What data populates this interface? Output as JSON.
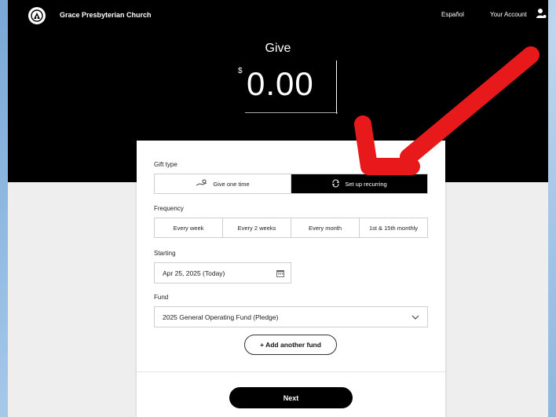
{
  "header": {
    "church_name": "Grace Presbyterian Church",
    "language_link": "Español",
    "account_link": "Your Account"
  },
  "give": {
    "title": "Give",
    "currency_symbol": "$",
    "amount": "0.00"
  },
  "form": {
    "gift_type_label": "Gift type",
    "gift_types": [
      {
        "label": "Give one time",
        "icon": "hand-coin-icon",
        "selected": false
      },
      {
        "label": "Set up recurring",
        "icon": "recurring-icon",
        "selected": true
      }
    ],
    "frequency_label": "Frequency",
    "frequencies": [
      "Every week",
      "Every 2 weeks",
      "Every month",
      "1st & 15th monthly"
    ],
    "starting_label": "Starting",
    "starting_value": "Apr 25, 2025 (Today)",
    "fund_label": "Fund",
    "fund_value": "2025 General Operating Fund (Pledge)",
    "add_fund_label": "+ Add another fund",
    "next_label": "Next"
  },
  "annotation": {
    "arrow_color": "#e8191b"
  }
}
